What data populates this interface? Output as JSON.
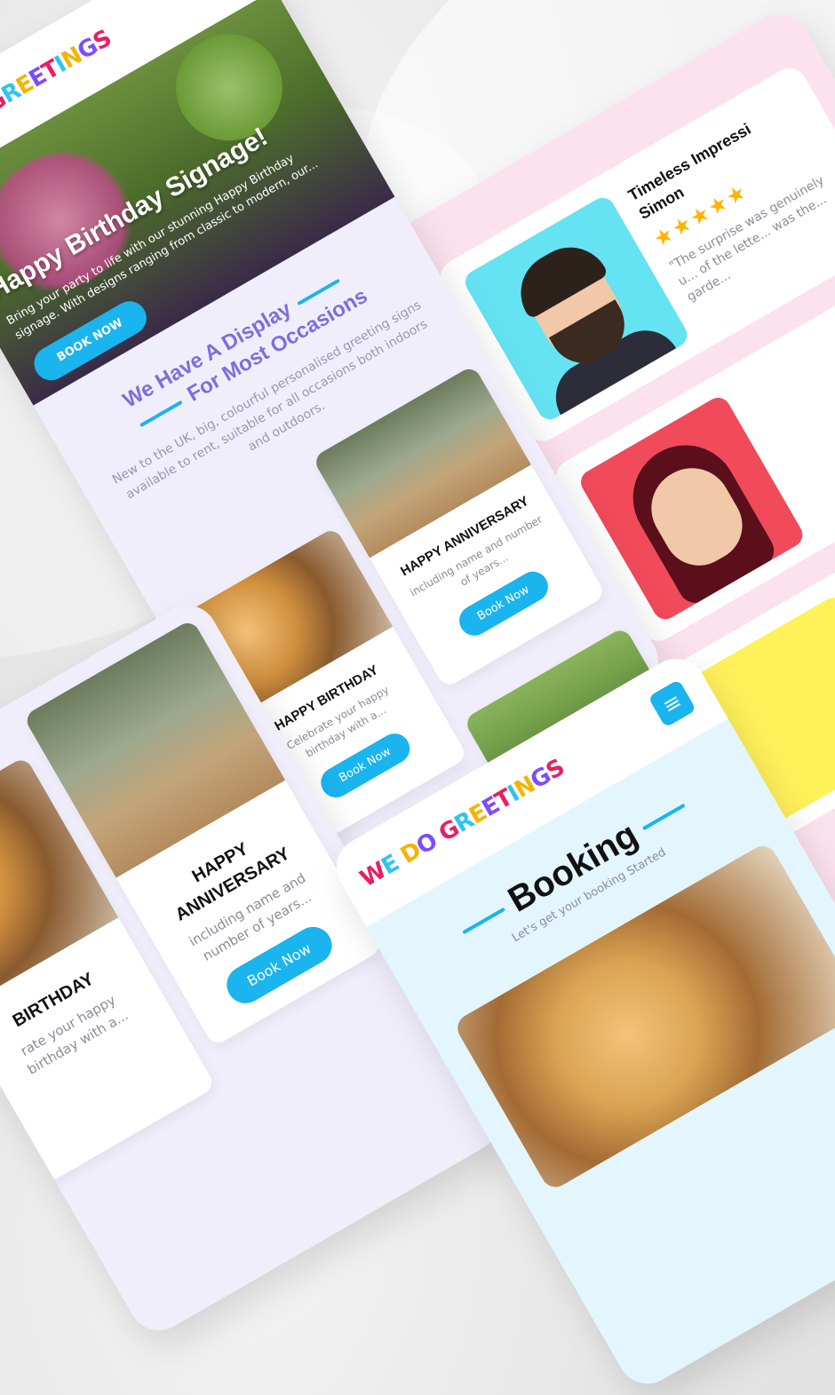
{
  "brand": {
    "logo_text": "WE DO GREETINGS",
    "accent": "#1ab4ee",
    "heading_purple": "#7b6fdc",
    "bg_lavender": "#f1eefc",
    "bg_pink": "#fce1ee",
    "bg_lightblue": "#e3f6fd"
  },
  "home": {
    "menu_icon": "hamburger-icon",
    "hero_title": "Happy Birthday Signage!",
    "hero_text": "Bring your party to life with our stunning Happy Birthday signage. With designs ranging from classic to modern, our...",
    "hero_button": "BOOK NOW",
    "section_title_1": "We Have A Display",
    "section_title_2": "For Most Occasions",
    "section_text": "New to the UK, big, colourful personalised greeting signs available to rent, suitable for all occasions both indoors and outdoors.",
    "cards": [
      {
        "title": "HAPPY BIRTHDAY",
        "text": "Celebrate your happy birthday with a...",
        "button": "Book Now",
        "image": "happy-birthday-sign"
      },
      {
        "title": "HAPPY ANNIVERSARY",
        "text": "including name and number of years...",
        "button": "Book Now",
        "image": "anniversary-sign"
      }
    ]
  },
  "reviews": [
    {
      "name": "Timeless Impressi",
      "reviewer": "Simon",
      "stars": "★★★★★",
      "quote": "\"The surprise was genuinely u... of the lette... was the... garde...",
      "avatar": "man-avatar"
    },
    {
      "name": "",
      "reviewer": "",
      "stars": "",
      "quote": "",
      "avatar": "woman-avatar"
    },
    {
      "name": "",
      "reviewer": "",
      "stars": "",
      "quote": "",
      "avatar": "yellow-avatar"
    }
  ],
  "left_view": {
    "cards": [
      {
        "title": "BIRTHDAY",
        "text": "rate your happy birthday with a...",
        "button": ""
      },
      {
        "title": "HAPPY ANNIVERSARY",
        "text": "including name and number of years...",
        "button": "Book Now"
      }
    ]
  },
  "booking": {
    "menu_icon": "hamburger-icon",
    "title": "Booking",
    "subtitle": "Let's get your booking Started"
  }
}
